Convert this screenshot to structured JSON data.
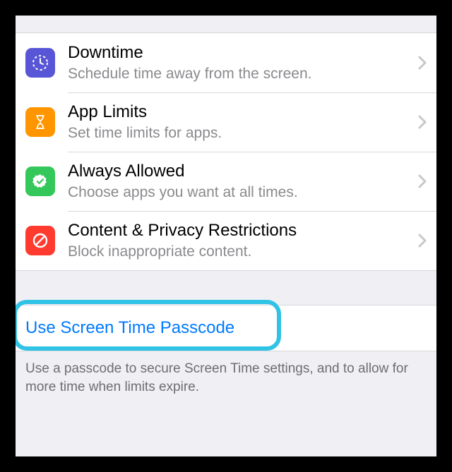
{
  "group1": {
    "items": [
      {
        "title": "Downtime",
        "subtitle": "Schedule time away from the screen."
      },
      {
        "title": "App Limits",
        "subtitle": "Set time limits for apps."
      },
      {
        "title": "Always Allowed",
        "subtitle": "Choose apps you want at all times."
      },
      {
        "title": "Content & Privacy Restrictions",
        "subtitle": "Block inappropriate content."
      }
    ]
  },
  "passcode": {
    "link": "Use Screen Time Passcode",
    "footer": "Use a passcode to secure Screen Time settings, and to allow for more time when limits expire."
  }
}
